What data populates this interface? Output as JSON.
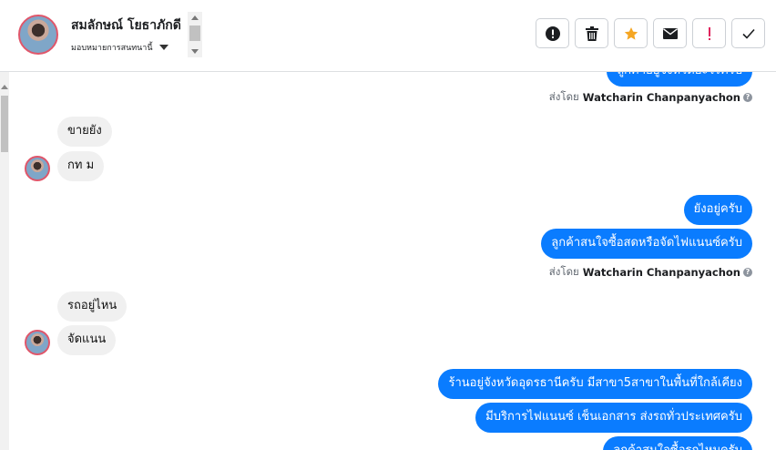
{
  "contact": {
    "name": "สมลักษณ์ โยธาภักดี",
    "assign_label": "มอบหมายการสนทนานี้"
  },
  "toolbar": {
    "buttons": [
      {
        "name": "alert-button",
        "icon": "exclamation-circle-icon"
      },
      {
        "name": "delete-button",
        "icon": "trash-icon"
      },
      {
        "name": "star-button",
        "icon": "star-icon",
        "color": "#f5a623"
      },
      {
        "name": "mark-unread-button",
        "icon": "envelope-icon"
      },
      {
        "name": "spam-button",
        "icon": "exclamation-icon",
        "color": "#e0245e"
      },
      {
        "name": "done-button",
        "icon": "check-icon"
      }
    ]
  },
  "colors": {
    "outgoing": "#0a7cff",
    "incoming": "#f0f0f0"
  },
  "messages": {
    "top_partial": "ลูกค้าอยู่จังหวัดอะไรครับ",
    "sent_by_prefix": "ส่งโดย",
    "sender": "Watcharin Chanpanyachon",
    "in_1": "ขายยัง",
    "in_2": "กท ม",
    "out_1": "ยังอยู่ครับ",
    "out_2": "ลูกค้าสนใจซื้อสดหรือจัดไฟแนนซ์ครับ",
    "in_3": "รถอยู่ไหน",
    "in_4": "จัดแนน",
    "out_3": "ร้านอยู่จังหวัดอุดรธานีครับ มีสาขา5สาขาในพื้นที่ใกล้เคียง",
    "out_4": "มีบริการไฟแนนซ์ เช็นเอกสาร ส่งรถทั่วประเทศครับ",
    "out_5_partial": "ลูกค้าสนใจซื้อรถไหมครับ"
  }
}
